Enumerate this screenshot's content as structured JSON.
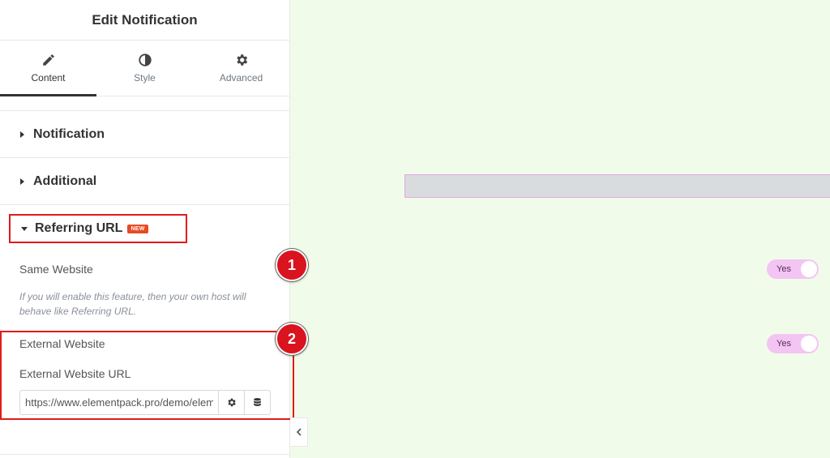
{
  "panel": {
    "title": "Edit Notification"
  },
  "tabs": [
    {
      "label": "Content",
      "icon": "pencil-icon",
      "active": true
    },
    {
      "label": "Style",
      "icon": "contrast-icon",
      "active": false
    },
    {
      "label": "Advanced",
      "icon": "gear-icon",
      "active": false
    }
  ],
  "sections": {
    "notification": "Notification",
    "additional": "Additional",
    "referring": {
      "label": "Referring URL",
      "badge": "NEW"
    }
  },
  "controls": {
    "same_website": {
      "label": "Same Website",
      "toggle": "Yes",
      "description": "If you will enable this feature, then your own host will behave like Referring URL."
    },
    "external_website": {
      "label": "External Website",
      "toggle": "Yes"
    },
    "external_url": {
      "label": "External Website URL",
      "value": "https://www.elementpack.pro/demo/element/notification/"
    }
  },
  "steps": [
    "1",
    "2"
  ],
  "colors": {
    "highlight": "#e01b1b",
    "toggle": "#f3c5f3",
    "badge": "#e64b23",
    "canvas": "#f1fbe9"
  }
}
